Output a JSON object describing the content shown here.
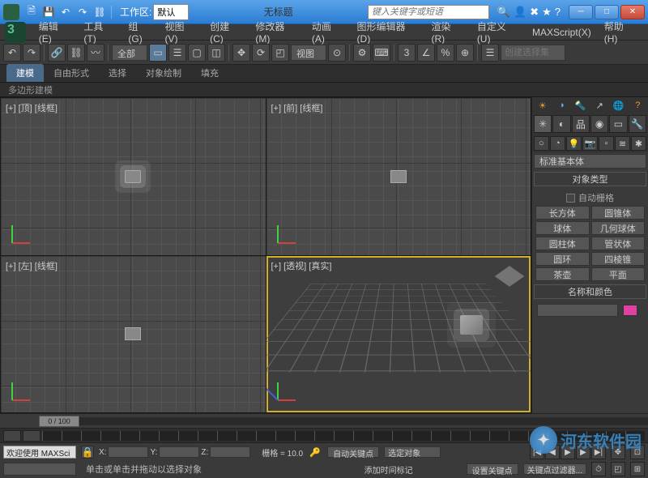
{
  "titlebar": {
    "workspace_label": "工作区:",
    "workspace_value": "默认",
    "title": "无标题",
    "search_placeholder": "键入关键字或短语"
  },
  "menu": {
    "items": [
      "编辑(E)",
      "工具(T)",
      "组(G)",
      "视图(V)",
      "创建(C)",
      "修改器(M)",
      "动画(A)",
      "图形编辑器(D)",
      "渲染(R)",
      "自定义(U)",
      "MAXScript(X)",
      "帮助(H)"
    ]
  },
  "toolbar": {
    "all_label": "全部",
    "view_label": "视图",
    "named_selection_placeholder": "创建选择集"
  },
  "ribbon": {
    "tabs": [
      "建模",
      "自由形式",
      "选择",
      "对象绘制",
      "填充"
    ],
    "sub": "多边形建模"
  },
  "viewports": {
    "v0": "[+] [顶] [线框]",
    "v1": "[+] [前] [线框]",
    "v2": "[+] [左] [线框]",
    "v3": "[+] [透视] [真实]"
  },
  "cmd": {
    "category": "标准基本体",
    "rollout_objtype": "对象类型",
    "auto_grid": "自动栅格",
    "objects": [
      "长方体",
      "圆锥体",
      "球体",
      "几何球体",
      "圆柱体",
      "管状体",
      "圆环",
      "四棱锥",
      "茶壶",
      "平面"
    ],
    "rollout_name": "名称和颜色"
  },
  "timeline": {
    "slider": "0 / 100"
  },
  "status": {
    "welcome": "欢迎使用  MAXSci",
    "prompt": "单击或单击并拖动以选择对象",
    "add_time_tag": "添加时间标记",
    "x": "X:",
    "y": "Y:",
    "z": "Z:",
    "grid": "栅格 = 10.0",
    "auto_key": "自动关键点",
    "set_key": "设置关键点",
    "selected": "选定对象",
    "key_filters": "关键点过滤器..."
  },
  "watermark": "河东软件园"
}
